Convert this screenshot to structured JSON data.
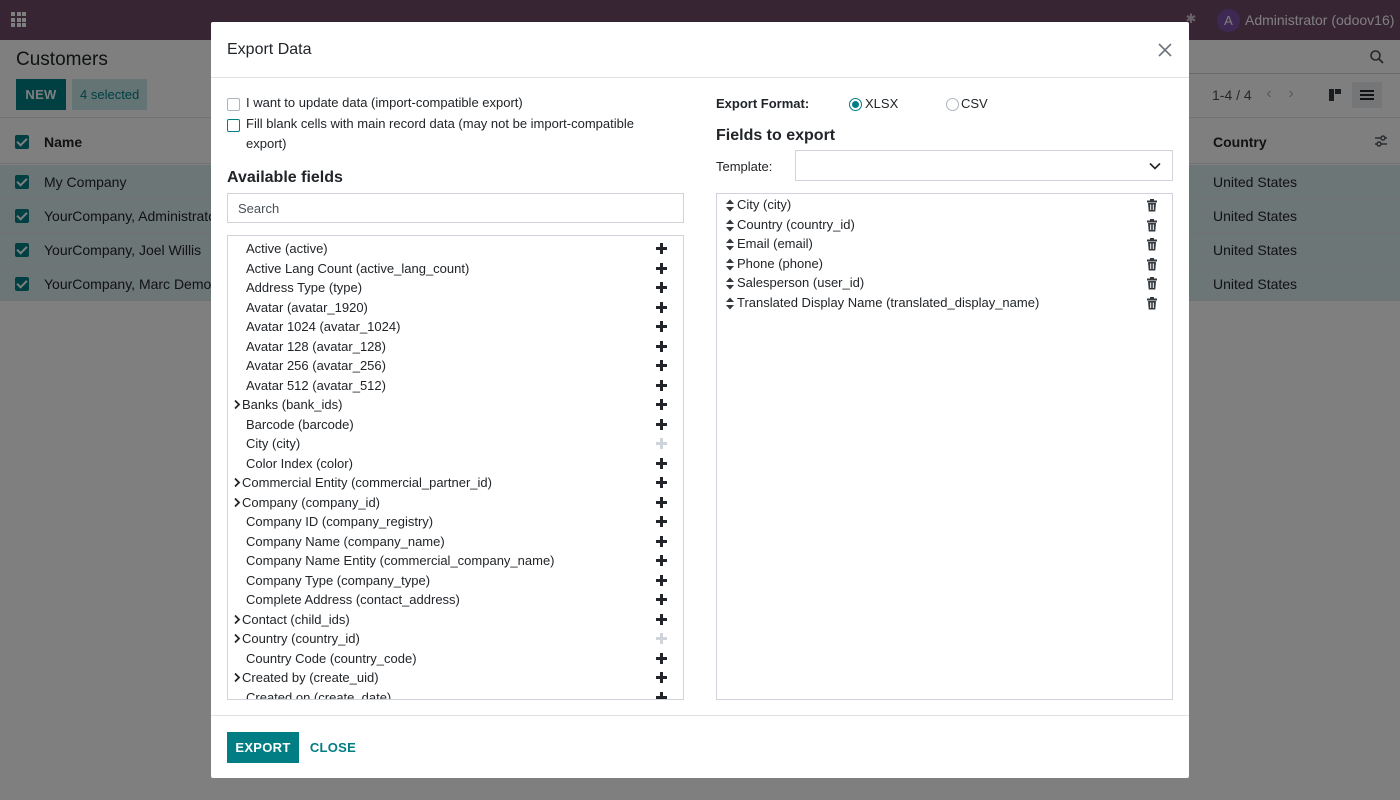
{
  "topbar": {
    "user_initial": "A",
    "user_name": "Administrator (odoov16)"
  },
  "control_panel": {
    "title": "Customers",
    "new_label": "NEW",
    "selected_label": "4 selected",
    "pager": "1-4 / 4"
  },
  "list": {
    "columns": [
      "Name",
      "Country"
    ],
    "rows": [
      {
        "name": "My Company",
        "country": "United States"
      },
      {
        "name": "YourCompany, Administrato",
        "country": "United States"
      },
      {
        "name": "YourCompany, Joel Willis",
        "country": "United States"
      },
      {
        "name": "YourCompany, Marc Demo",
        "country": "United States"
      }
    ]
  },
  "modal": {
    "title": "Export Data",
    "options": {
      "import_compat": "I want to update data (import-compatible export)",
      "fill_blank_line1": "Fill blank cells with main record data (may not be import-compatible",
      "fill_blank_line2": "export)"
    },
    "available_title": "Available fields",
    "search_placeholder": "Search",
    "available_fields": [
      {
        "label": "Active (active)",
        "expandable": false,
        "added": false
      },
      {
        "label": "Active Lang Count (active_lang_count)",
        "expandable": false,
        "added": false
      },
      {
        "label": "Address Type (type)",
        "expandable": false,
        "added": false
      },
      {
        "label": "Avatar (avatar_1920)",
        "expandable": false,
        "added": false
      },
      {
        "label": "Avatar 1024 (avatar_1024)",
        "expandable": false,
        "added": false
      },
      {
        "label": "Avatar 128 (avatar_128)",
        "expandable": false,
        "added": false
      },
      {
        "label": "Avatar 256 (avatar_256)",
        "expandable": false,
        "added": false
      },
      {
        "label": "Avatar 512 (avatar_512)",
        "expandable": false,
        "added": false
      },
      {
        "label": "Banks (bank_ids)",
        "expandable": true,
        "added": false
      },
      {
        "label": "Barcode (barcode)",
        "expandable": false,
        "added": false
      },
      {
        "label": "City (city)",
        "expandable": false,
        "added": true
      },
      {
        "label": "Color Index (color)",
        "expandable": false,
        "added": false
      },
      {
        "label": "Commercial Entity (commercial_partner_id)",
        "expandable": true,
        "added": false
      },
      {
        "label": "Company (company_id)",
        "expandable": true,
        "added": false
      },
      {
        "label": "Company ID (company_registry)",
        "expandable": false,
        "added": false
      },
      {
        "label": "Company Name (company_name)",
        "expandable": false,
        "added": false
      },
      {
        "label": "Company Name Entity (commercial_company_name)",
        "expandable": false,
        "added": false
      },
      {
        "label": "Company Type (company_type)",
        "expandable": false,
        "added": false
      },
      {
        "label": "Complete Address (contact_address)",
        "expandable": false,
        "added": false
      },
      {
        "label": "Contact (child_ids)",
        "expandable": true,
        "added": false
      },
      {
        "label": "Country (country_id)",
        "expandable": true,
        "added": true
      },
      {
        "label": "Country Code (country_code)",
        "expandable": false,
        "added": false
      },
      {
        "label": "Created by (create_uid)",
        "expandable": true,
        "added": false
      },
      {
        "label": "Created on (create_date)",
        "expandable": false,
        "added": false
      }
    ],
    "export_format_label": "Export Format:",
    "formats": [
      {
        "label": "XLSX",
        "selected": true
      },
      {
        "label": "CSV",
        "selected": false
      }
    ],
    "fields_to_export_title": "Fields to export",
    "template_label": "Template:",
    "template_value": "",
    "export_fields": [
      "City (city)",
      "Country (country_id)",
      "Email (email)",
      "Phone (phone)",
      "Salesperson (user_id)",
      "Translated Display Name (translated_display_name)"
    ],
    "export_button": "EXPORT",
    "close_button": "CLOSE"
  },
  "colors": {
    "brand_top": "#714b67",
    "primary": "#017e84",
    "selected_row": "#dbeced"
  }
}
